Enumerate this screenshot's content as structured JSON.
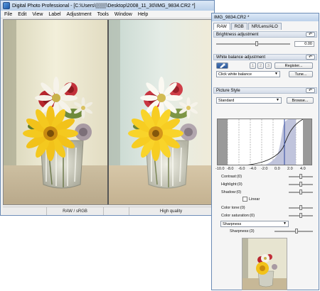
{
  "main_window": {
    "title": "Digital Photo Professional - [C:\\Users\\▒▒▒\\Desktop\\2008_11_30\\IMG_9834.CR2 *]",
    "menu": [
      "File",
      "Edit",
      "View",
      "Label",
      "Adjustment",
      "Tools",
      "Window",
      "Help"
    ],
    "status": {
      "color_space": "RAW / sRGB",
      "quality": "High quality"
    }
  },
  "tool_palette": {
    "title": "IMG_9834.CR2 *",
    "tabs": [
      "RAW",
      "RGB",
      "NR/Lens/ALO"
    ],
    "active_tab": "RAW",
    "brightness": {
      "header": "Brightness adjustment",
      "value": "0.00"
    },
    "white_balance": {
      "header": "White balance adjustment",
      "slot_labels": [
        "1",
        "2",
        "3"
      ],
      "register_label": "Register...",
      "mode_value": "Click white balance",
      "tune_label": "Tune..."
    },
    "picture_style": {
      "header": "Picture Style",
      "style_value": "Standard",
      "browse_label": "Browse...",
      "axis_ticks": [
        "-10.0",
        "-8.0",
        "-6.0",
        "-4.0",
        "-2.0",
        "0.0",
        "2.0",
        "4.0"
      ],
      "contrast_label": "Contrast:(0)",
      "highlight_label": "Highlight:(0)",
      "shadow_label": "Shadow:(0)",
      "linear_label": "Linear",
      "color_tone_label": "Color tone:(0)",
      "color_saturation_label": "Color saturation:(0)",
      "sharpness_mode": "Sharpness",
      "sharpness_label": "Sharpness:(3)"
    },
    "reset_glyph": "↶"
  },
  "colors": {
    "title_bar": "#c8dbf0",
    "accent_border": "#6b8bb5",
    "flower_yellow": "#f2c21a",
    "flower_red": "#b8262e"
  }
}
